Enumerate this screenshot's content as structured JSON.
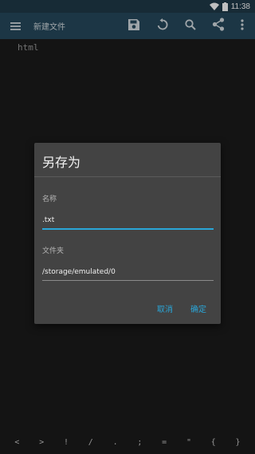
{
  "status_bar": {
    "time": "11:38",
    "wifi_icon": "wifi-icon",
    "battery_icon": "battery-icon"
  },
  "toolbar": {
    "title": "新建文件",
    "icons": [
      "menu-icon",
      "save-icon",
      "undo-icon",
      "search-icon",
      "share-icon",
      "more-vert-icon"
    ]
  },
  "editor": {
    "text": "html"
  },
  "dialog": {
    "title": "另存为",
    "name_label": "名称",
    "name_value": ".txt",
    "folder_label": "文件夹",
    "folder_value": "/storage/emulated/0",
    "cancel_label": "取消",
    "ok_label": "确定"
  },
  "symbol_bar": {
    "keys": [
      "<",
      ">",
      "!",
      "/",
      ".",
      ";",
      "=",
      "\"",
      "{",
      "}"
    ]
  },
  "colors": {
    "toolbar": "#26495c",
    "status_bar": "#1f3a49",
    "accent": "#2aa6d8",
    "dialog_bg": "#434343",
    "editor_bg": "#1b1b1b"
  }
}
